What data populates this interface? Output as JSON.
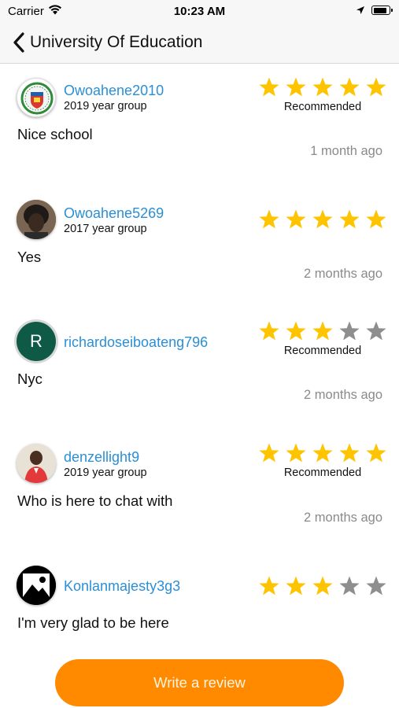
{
  "status_bar": {
    "carrier": "Carrier",
    "time": "10:23 AM",
    "battery_level": 0.9
  },
  "nav": {
    "back_icon": "chevron-left-icon",
    "title": "University Of Education"
  },
  "colors": {
    "accent": "#ff8a00",
    "username": "#2a8fd6",
    "star_filled": "#ffc400",
    "star_empty": "#8e8e8e",
    "timestamp": "#8a8a8a"
  },
  "reviews": [
    {
      "username": "Owoahene2010",
      "group": "2019 year group",
      "rating": 5,
      "recommended": "Recommended",
      "text": "Nice school",
      "ago": "1 month ago",
      "avatar": "school-crest-avatar"
    },
    {
      "username": "Owoahene5269",
      "group": "2017 year group",
      "rating": 5,
      "recommended": "",
      "text": "Yes",
      "ago": "2 months ago",
      "avatar": "photo-avatar"
    },
    {
      "username": "richardoseiboateng796",
      "group": "",
      "rating": 3,
      "recommended": "Recommended",
      "text": "Nyc",
      "ago": "2 months ago",
      "avatar": "letter-avatar",
      "avatar_letter": "R"
    },
    {
      "username": "denzellight9",
      "group": "2019 year group",
      "rating": 5,
      "recommended": "Recommended",
      "text": "Who is here to chat with",
      "ago": "2 months ago",
      "avatar": "photo-avatar"
    },
    {
      "username": "Konlanmajesty3g3",
      "group": "",
      "rating": 3,
      "recommended": "",
      "text": "I'm very glad to be here",
      "ago": "",
      "avatar": "placeholder-image-avatar"
    }
  ],
  "write_review_button": "Write a review"
}
